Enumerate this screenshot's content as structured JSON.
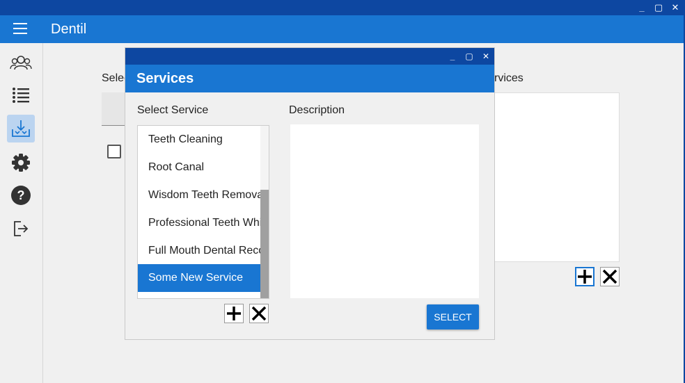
{
  "window": {
    "controls": {
      "minimize": "_",
      "maximize": "▢",
      "close": "✕"
    }
  },
  "app": {
    "title": "Dentil",
    "menu_icon": "hamburger-menu-icon"
  },
  "sidebar": {
    "items": [
      {
        "icon": "users-icon",
        "active": false
      },
      {
        "icon": "list-icon",
        "active": false
      },
      {
        "icon": "download-tray-icon",
        "active": true
      },
      {
        "icon": "gear-icon",
        "active": false
      },
      {
        "icon": "help-icon",
        "active": false
      },
      {
        "icon": "logout-icon",
        "active": false
      }
    ]
  },
  "background": {
    "left_label": "Selec",
    "right_label": "rvices"
  },
  "dialog": {
    "controls": {
      "minimize": "_",
      "maximize": "▢",
      "close": "✕"
    },
    "title": "Services",
    "select_label": "Select Service",
    "description_label": "Description",
    "services": [
      "Teeth Cleaning",
      "Root Canal",
      "Wisdom Teeth Removal",
      "Professional Teeth Whitening",
      "Full Mouth Dental Reconstruction",
      "Some New Service"
    ],
    "selected_service": "Some New Service",
    "description_value": "",
    "select_button": "SELECT",
    "scroll_position": 0.37
  },
  "colors": {
    "titlebar": "#0d47a1",
    "accent": "#1976d2",
    "active_nav": "#bbd4f0"
  }
}
